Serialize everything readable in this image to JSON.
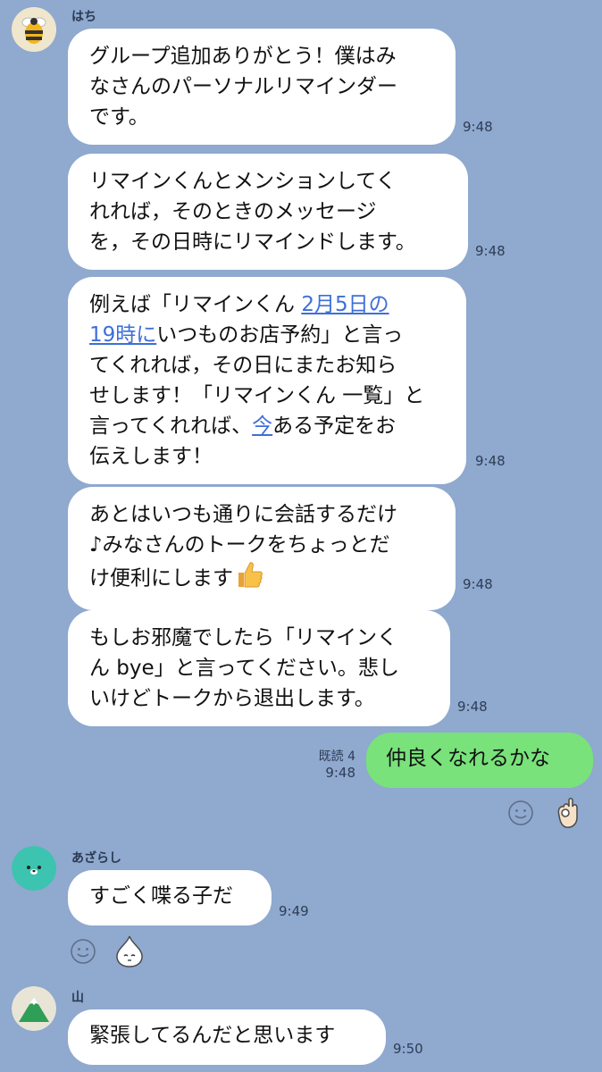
{
  "chat": {
    "messages": [
      {
        "sender": "はち",
        "lines": [
          "グループ追加ありがとう！僕はみ",
          "なさんのパーソナルリマインダー",
          "です。"
        ],
        "time": "9:48"
      },
      {
        "lines": [
          "リマインくんとメンションしてく",
          "れれば，そのときのメッセージ",
          "を，その日時にリマインドします。"
        ],
        "time": "9:48"
      },
      {
        "line1_pre": "例えば「リマインくん ",
        "line1_link": "2月5日の",
        "line2_link": "19時に",
        "line2_post": "いつものお店予約」と言っ",
        "line3": "てくれれば，その日にまたお知ら",
        "line4": "せします！「リマインくん 一覧」と",
        "line5_pre": "言ってくれれば、",
        "line5_link": "今",
        "line5_post": "ある予定をお",
        "line6": "伝えします！",
        "time": "9:48"
      },
      {
        "lines": [
          "あとはいつも通りに会話するだけ",
          "♪みなさんのトークをちょっとだ",
          "け便利にします"
        ],
        "time": "9:48"
      },
      {
        "lines": [
          "もしお邪魔でしたら「リマインく",
          "ん bye」と言ってください。悲し",
          "いけどトークから退出します。"
        ],
        "time": "9:48"
      },
      {
        "text": "仲良くなれるかな",
        "read": "既読 4",
        "time": "9:48"
      },
      {
        "sender": "あざらし",
        "text": "すごく喋る子だ",
        "time": "9:49"
      },
      {
        "sender": "山",
        "text": "緊張してるんだと思います",
        "time": "9:50"
      }
    ]
  },
  "icons": {
    "bee": "bee-avatar-icon",
    "seal": "seal-avatar-icon",
    "mountain": "mountain-avatar-icon",
    "thumbs": "thumbs-up-emoji",
    "ok": "ok-hand-sticker",
    "smile": "add-reaction-icon",
    "drop": "onion-sticker-icon"
  },
  "colors": {
    "background": "#8fa9cf",
    "incoming": "#ffffff",
    "outgoing": "#79e27b",
    "link": "#3d6fd8"
  }
}
